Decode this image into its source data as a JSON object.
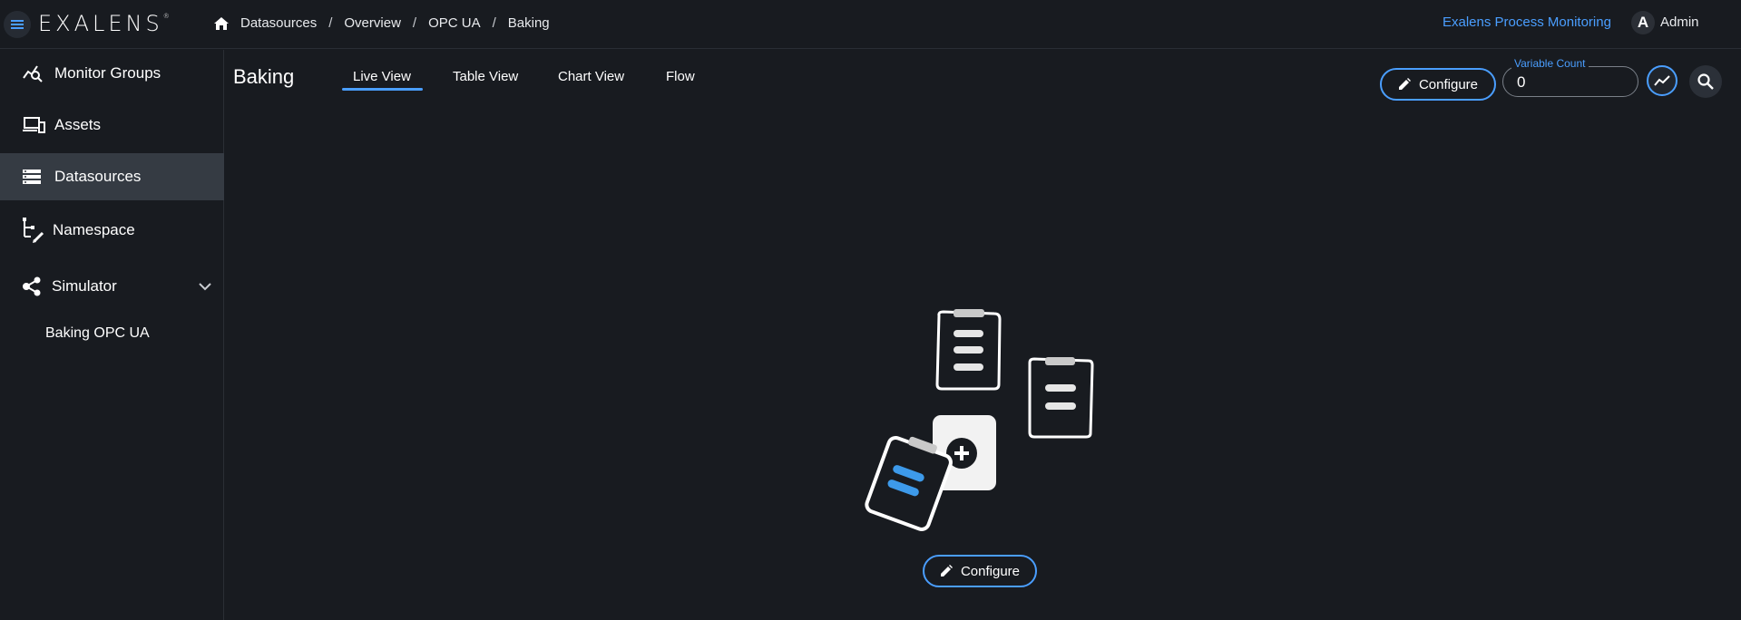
{
  "header": {
    "logo": "EXALENS",
    "breadcrumb": [
      "Datasources",
      "Overview",
      "OPC UA",
      "Baking"
    ],
    "app_name": "Exalens Process Monitoring",
    "user": {
      "initial": "A",
      "name": "Admin"
    }
  },
  "sidebar": {
    "items": [
      {
        "label": "Monitor Groups",
        "icon": "monitor-groups-icon"
      },
      {
        "label": "Assets",
        "icon": "assets-icon"
      },
      {
        "label": "Datasources",
        "icon": "datasources-icon",
        "active": true
      },
      {
        "label": "Namespace",
        "icon": "namespace-icon"
      },
      {
        "label": "Simulator",
        "icon": "simulator-icon",
        "expanded": true
      }
    ],
    "sub_items": [
      "Baking OPC UA"
    ]
  },
  "main": {
    "title": "Baking",
    "tabs": [
      {
        "label": "Live View",
        "active": true
      },
      {
        "label": "Table View"
      },
      {
        "label": "Chart View"
      },
      {
        "label": "Flow"
      }
    ],
    "configure_label": "Configure",
    "variable_count": {
      "label": "Variable Count",
      "value": "0"
    },
    "empty_state": {
      "configure_label": "Configure"
    }
  },
  "colors": {
    "accent": "#4a9eff",
    "background": "#181b20",
    "active_item": "#353b43"
  }
}
